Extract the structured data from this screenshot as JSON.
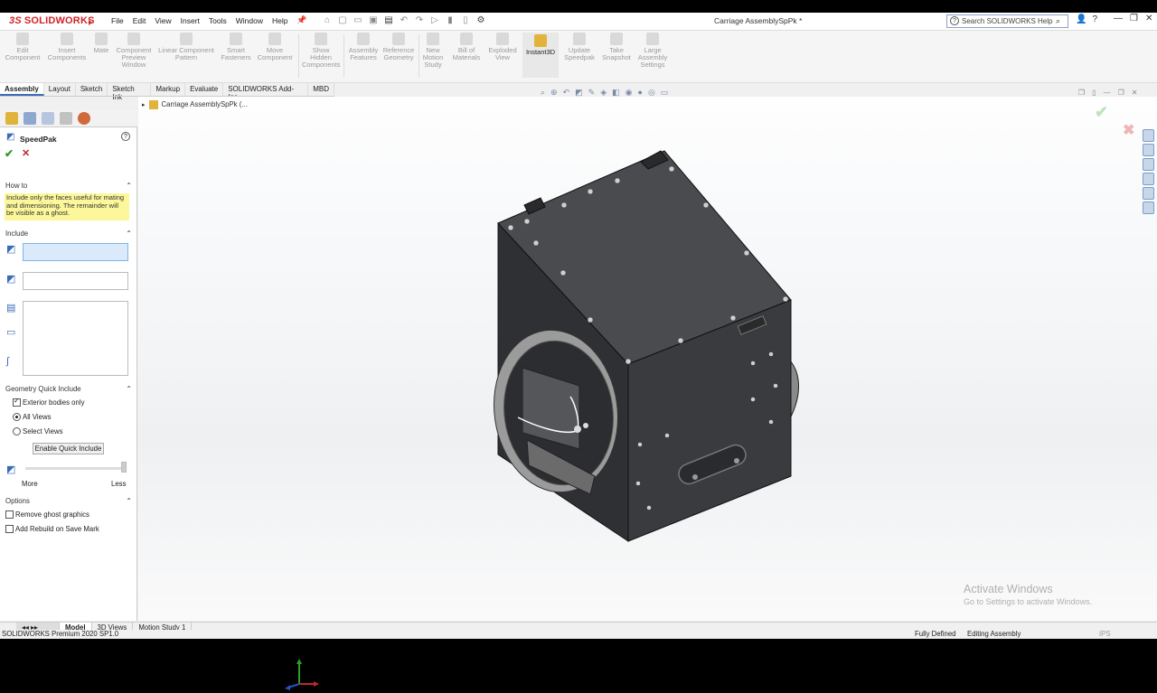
{
  "app": {
    "brand": "SOLIDWORKS",
    "document_title": "Carriage AssemblySpPk *",
    "search_placeholder": "Search SOLIDWORKS Help",
    "menus": [
      "File",
      "Edit",
      "View",
      "Insert",
      "Tools",
      "Window",
      "Help"
    ]
  },
  "ribbon": {
    "buttons": [
      {
        "label": "Edit Component",
        "active": false
      },
      {
        "label": "Insert Components",
        "active": false
      },
      {
        "label": "Mate",
        "active": false
      },
      {
        "label": "Component Preview Window",
        "active": false
      },
      {
        "label": "Linear Component Pattern",
        "active": false
      },
      {
        "label": "Smart Fasteners",
        "active": false
      },
      {
        "label": "Move Component",
        "active": false
      },
      {
        "label": "Show Hidden Components",
        "active": false
      },
      {
        "label": "Assembly Features",
        "active": false
      },
      {
        "label": "Reference Geometry",
        "active": false
      },
      {
        "label": "New Motion Study",
        "active": false
      },
      {
        "label": "Bill of Materials",
        "active": false
      },
      {
        "label": "Exploded View",
        "active": false
      },
      {
        "label": "Instant3D",
        "active": true
      },
      {
        "label": "Update Speedpak",
        "active": false
      },
      {
        "label": "Take Snapshot",
        "active": false
      },
      {
        "label": "Large Assembly Settings",
        "active": false
      }
    ]
  },
  "tabs": [
    "Assembly",
    "Layout",
    "Sketch",
    "Sketch Ink",
    "Markup",
    "Evaluate",
    "SOLIDWORKS Add-Ins",
    "MBD"
  ],
  "panel": {
    "title": "SpeedPak",
    "how_to_header": "How to",
    "how_to_text": "Include only the faces useful for mating and dimensioning.  The remainder will be visible as a ghost.",
    "include_header": "Include",
    "geometry_header": "Geometry Quick Include",
    "exterior_label": "Exterior bodies only",
    "exterior_checked": true,
    "all_views_label": "All Views",
    "select_views_label": "Select Views",
    "enable_button": "Enable Quick Include",
    "more_label": "More",
    "less_label": "Less",
    "options_header": "Options",
    "remove_ghost_label": "Remove ghost graphics",
    "add_rebuild_label": "Add Rebuild on Save Mark"
  },
  "tree": {
    "root_label": "Carriage AssemblySpPk",
    "root_suffix": "(..."
  },
  "watermark": {
    "line1": "Activate Windows",
    "line2": "Go to Settings to activate Windows."
  },
  "bottom_tabs": [
    "Model",
    "3D Views",
    "Motion Study 1"
  ],
  "status": {
    "product": "SOLIDWORKS Premium 2020 SP1.0",
    "defined": "Fully Defined",
    "mode": "Editing Assembly",
    "units": "IPS"
  },
  "colors": {
    "brand_red": "#d0242b",
    "active_tab_blue": "#3a6ab8",
    "howto_yellow": "#fbf79a",
    "model_body": "#3b3c3f"
  }
}
